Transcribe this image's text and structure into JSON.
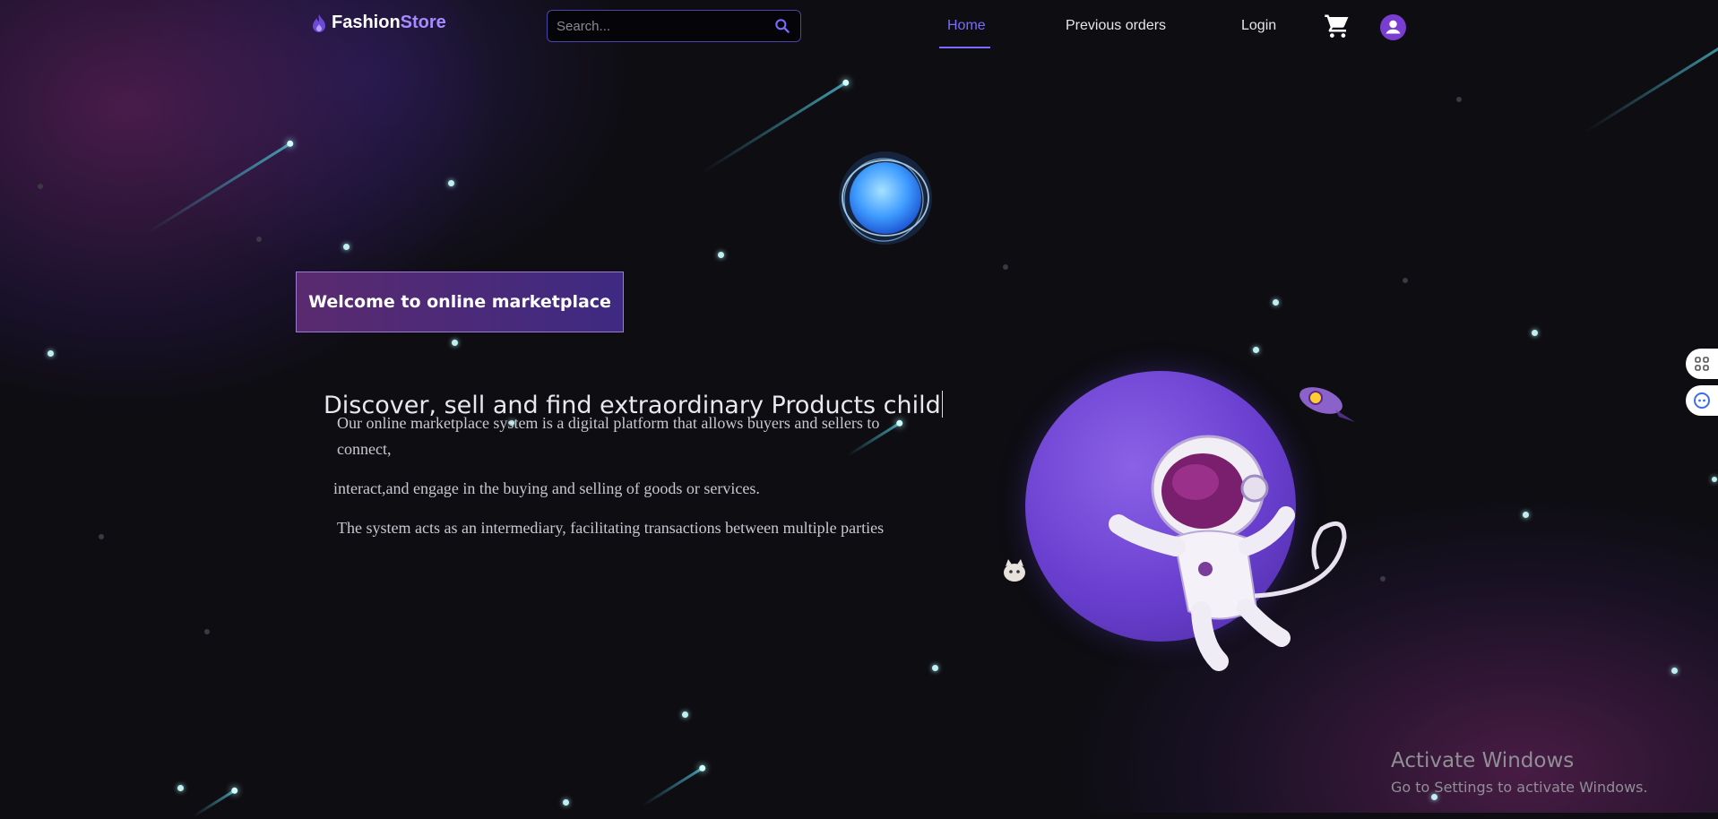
{
  "nav": {
    "logo_main": "Fashion",
    "logo_accent": "Store",
    "logo_icon": "flame-icon",
    "search_placeholder": "Search...",
    "search_icon": "search-icon",
    "links": [
      "Home",
      "Previous orders",
      "Login"
    ],
    "active_link": "Home",
    "cart_icon": "cart-icon",
    "user_icon": "user-avatar-icon"
  },
  "hero": {
    "welcome_label": "Welcome to online marketplace",
    "headline": "Discover, sell and find extraordinary Products child",
    "paragraph_1": "Our online marketplace system is a digital platform that allows buyers and sellers to connect,",
    "paragraph_2": "interact,and engage in the buying and selling of goods or services.",
    "paragraph_3": "The system acts as an intermediary, facilitating transactions between multiple parties"
  },
  "side_widgets": [
    "grid-icon",
    "assistant-icon"
  ],
  "watermark": {
    "title": "Activate Windows",
    "subtitle": "Go to Settings to activate Windows."
  },
  "colors": {
    "accent": "#7b6cff",
    "button_from": "#5a2a6f",
    "button_to": "#3e2a82",
    "background": "#0e0d12"
  }
}
